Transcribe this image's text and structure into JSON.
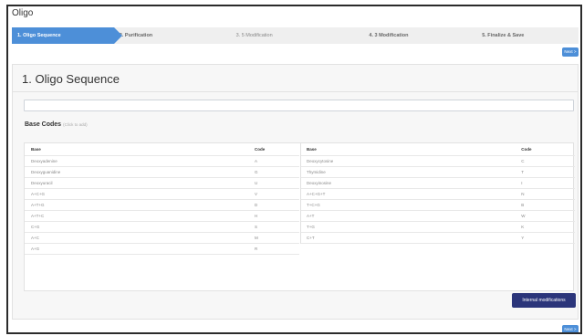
{
  "app": {
    "title": "Oligo"
  },
  "wizard": {
    "steps": [
      {
        "label": "1. Oligo Sequence"
      },
      {
        "label": "2. Purification"
      },
      {
        "label": "3. 5 Modification"
      },
      {
        "label": "4. 3 Modification"
      },
      {
        "label": "5. Finalize & Save"
      }
    ],
    "active_step": 1,
    "next_label": "Next >"
  },
  "main": {
    "title": "1. Oligo Sequence",
    "sequence_input": {
      "value": "",
      "placeholder": ""
    },
    "base_codes": {
      "title": "Base Codes",
      "hint": "(Click to add)"
    },
    "table": {
      "headers": {
        "base": "Base",
        "code": "Code"
      },
      "left_rows": [
        {
          "base": "Deoxyadenine",
          "code": "A"
        },
        {
          "base": "Deoxyguanidine",
          "code": "G"
        },
        {
          "base": "Deoxyuracil",
          "code": "U"
        },
        {
          "base": "A+C+G",
          "code": "V"
        },
        {
          "base": "A+T+G",
          "code": "D"
        },
        {
          "base": "A+T+C",
          "code": "H"
        },
        {
          "base": "C+G",
          "code": "S"
        },
        {
          "base": "A+C",
          "code": "M"
        },
        {
          "base": "A+G",
          "code": "R"
        }
      ],
      "right_rows": [
        {
          "base": "Deoxycytosine",
          "code": "C"
        },
        {
          "base": "Thymidine",
          "code": "T"
        },
        {
          "base": "Deoxyinosine",
          "code": "I"
        },
        {
          "base": "A+C+G+T",
          "code": "N"
        },
        {
          "base": "T+C+G",
          "code": "B"
        },
        {
          "base": "A+T",
          "code": "W"
        },
        {
          "base": "T+G",
          "code": "K"
        },
        {
          "base": "C+T",
          "code": "Y"
        }
      ]
    },
    "internal_modifications_label": "Internal modifications"
  },
  "colors": {
    "accent": "#4d8fd8",
    "dark_button": "#2b357a"
  }
}
